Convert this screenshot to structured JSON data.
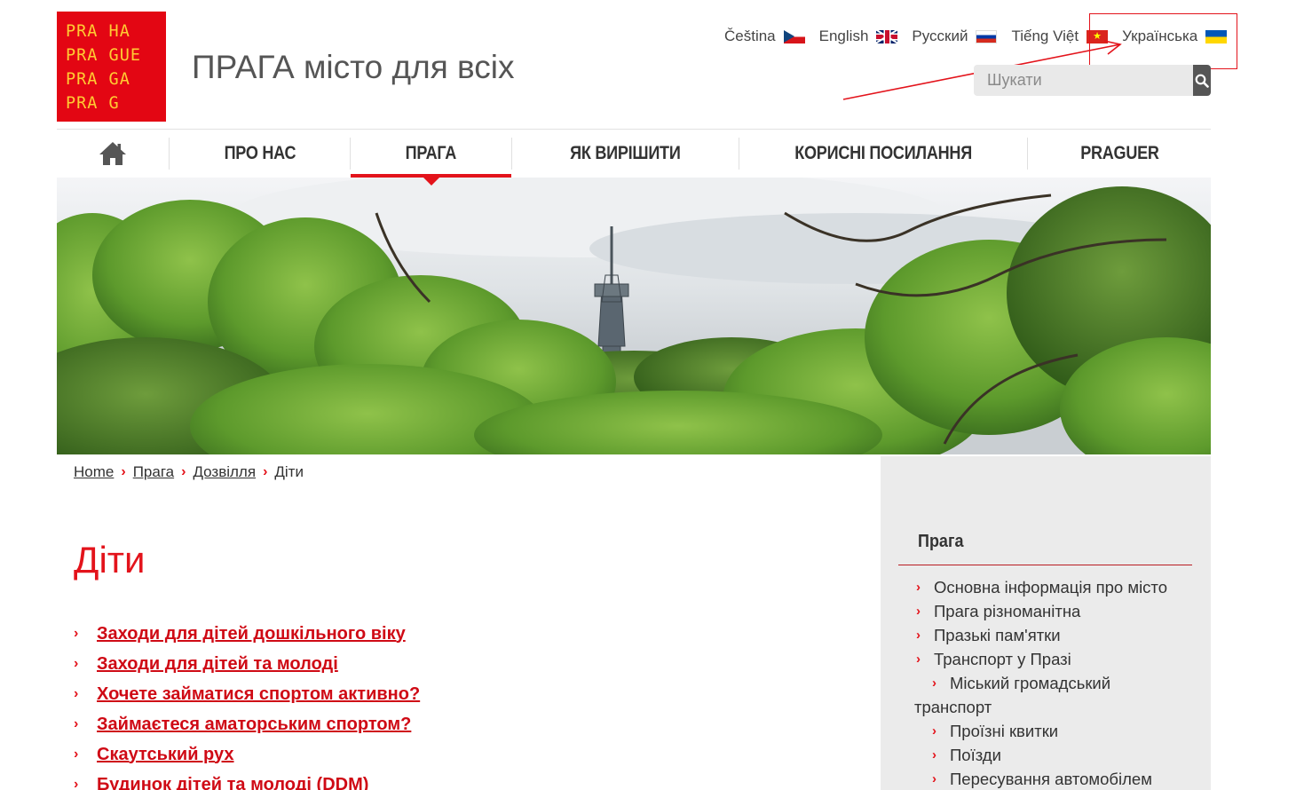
{
  "logo": {
    "lines": [
      "PRA HA",
      "PRA GUE",
      "PRA GA",
      "PRA G"
    ]
  },
  "site_title": "ПРАГА місто для всіх",
  "languages": [
    {
      "label": "Čeština",
      "flag": "cz-flag-icon"
    },
    {
      "label": "English",
      "flag": "gb-flag-icon"
    },
    {
      "label": "Русский",
      "flag": "ru-flag-icon"
    },
    {
      "label": "Tiếng Việt",
      "flag": "vn-flag-icon"
    },
    {
      "label": "Українська",
      "flag": "ua-flag-icon",
      "active": true
    }
  ],
  "search": {
    "placeholder": "Шукати",
    "value": "",
    "icon": "search-icon"
  },
  "nav": {
    "home_icon": "home-icon",
    "items": [
      {
        "label": "Про нас"
      },
      {
        "label": "Прага",
        "active": true
      },
      {
        "label": "Як вирішити"
      },
      {
        "label": "Корисні посилання"
      },
      {
        "label": "Praguer"
      }
    ]
  },
  "breadcrumb": [
    {
      "label": "Home"
    },
    {
      "label": "Прага"
    },
    {
      "label": "Дозвілля"
    },
    {
      "label": "Діти",
      "current": true
    }
  ],
  "page_title": "Діти",
  "links": [
    "Заходи для дітей дошкільного віку",
    "Заходи для дітей та молоді",
    "Хочете займатися спортом активно?",
    "Займаєтеся аматорським спортом?",
    "Скаутський рух",
    "Будинок дітей та молоді (DDM)"
  ],
  "sidebar": {
    "title": "Прага",
    "items": [
      {
        "label": "Основна інформація про місто",
        "level": 1
      },
      {
        "label": "Прага різноманітна",
        "level": 1
      },
      {
        "label": "Празькі пам'ятки",
        "level": 1
      },
      {
        "label": "Транспорт у Празі",
        "level": 1
      },
      {
        "label_line1": "Міський громадський",
        "label_line2": "транспорт",
        "level": 2
      },
      {
        "label": "Проїзні квитки",
        "level": 2
      },
      {
        "label": "Поїзди",
        "level": 2
      },
      {
        "label": "Пересування автомобілем",
        "level": 2
      }
    ]
  },
  "colors": {
    "brand_red": "#e3131b",
    "logo_yellow": "#ffcc33",
    "sidebar_bg": "#ebebeb"
  }
}
